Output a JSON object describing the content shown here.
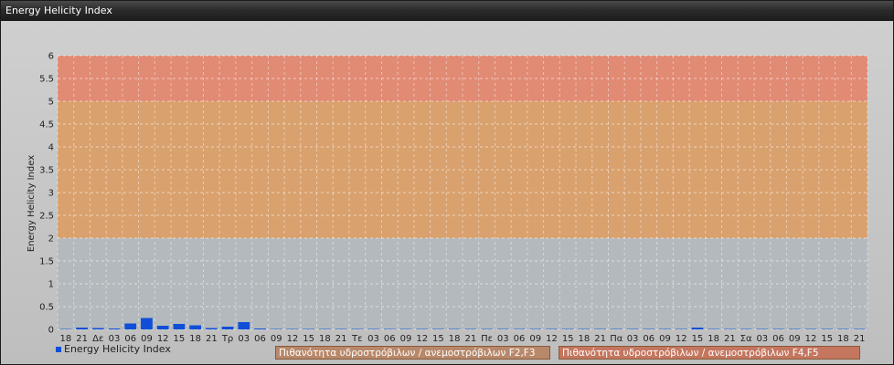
{
  "window": {
    "title": "Energy Helicity Index"
  },
  "colors": {
    "band_low": "#b3b9bd",
    "band_mid": "#d9a16e",
    "band_high": "#e18a74",
    "bar": "#0f4fd8"
  },
  "legend": {
    "series_label": "Energy Helicity Index",
    "risk_f23": "Πιθανότητα υδροστρόβιλων / ανεμοστρόβιλων F2,F3",
    "risk_f45": "Πιθανότητα υδροστρόβιλων / ανεμοστρόβιλων F4,F5"
  },
  "chart_data": {
    "type": "bar",
    "title": "",
    "xlabel": "",
    "ylabel": "Energy Helicity Index",
    "ylim": [
      0,
      6
    ],
    "yticks": [
      "0",
      "0.5",
      "1",
      "1.5",
      "2",
      "2.5",
      "3",
      "3.5",
      "4",
      "4.5",
      "5",
      "5.5",
      "6"
    ],
    "grid": true,
    "bands": [
      {
        "from": 0,
        "to": 2,
        "color": "#b3b9bd"
      },
      {
        "from": 2,
        "to": 5,
        "color": "#d9a16e"
      },
      {
        "from": 5,
        "to": 6,
        "color": "#e18a74"
      }
    ],
    "x_tick_labels": [
      "18",
      "21",
      "Δε",
      "03",
      "06",
      "09",
      "12",
      "15",
      "18",
      "21",
      "Τρ",
      "03",
      "06",
      "09",
      "12",
      "15",
      "18",
      "21",
      "Τε",
      "03",
      "06",
      "09",
      "12",
      "15",
      "18",
      "21",
      "Πε",
      "03",
      "06",
      "09",
      "12",
      "15",
      "18",
      "21",
      "Πα",
      "03",
      "06",
      "09",
      "12",
      "15",
      "18",
      "21",
      "Σα",
      "03",
      "06",
      "09",
      "12",
      "15",
      "18",
      "21"
    ],
    "series": [
      {
        "name": "Energy Helicity Index",
        "values": [
          0.0,
          0.04,
          0.03,
          0.02,
          0.13,
          0.25,
          0.08,
          0.12,
          0.09,
          0.03,
          0.06,
          0.16,
          0.02,
          0.0,
          0.0,
          0.0,
          0.01,
          0.0,
          0.0,
          0.0,
          0.0,
          0.0,
          0.0,
          0.0,
          0.0,
          0.0,
          0.0,
          0.0,
          0.0,
          0.0,
          0.0,
          0.0,
          0.0,
          0.0,
          0.0,
          0.0,
          0.0,
          0.0,
          0.01,
          0.04,
          0.0,
          0.0,
          0.0,
          0.0,
          0.0,
          0.0,
          0.0,
          0.0,
          0.0,
          0.0
        ]
      }
    ]
  }
}
